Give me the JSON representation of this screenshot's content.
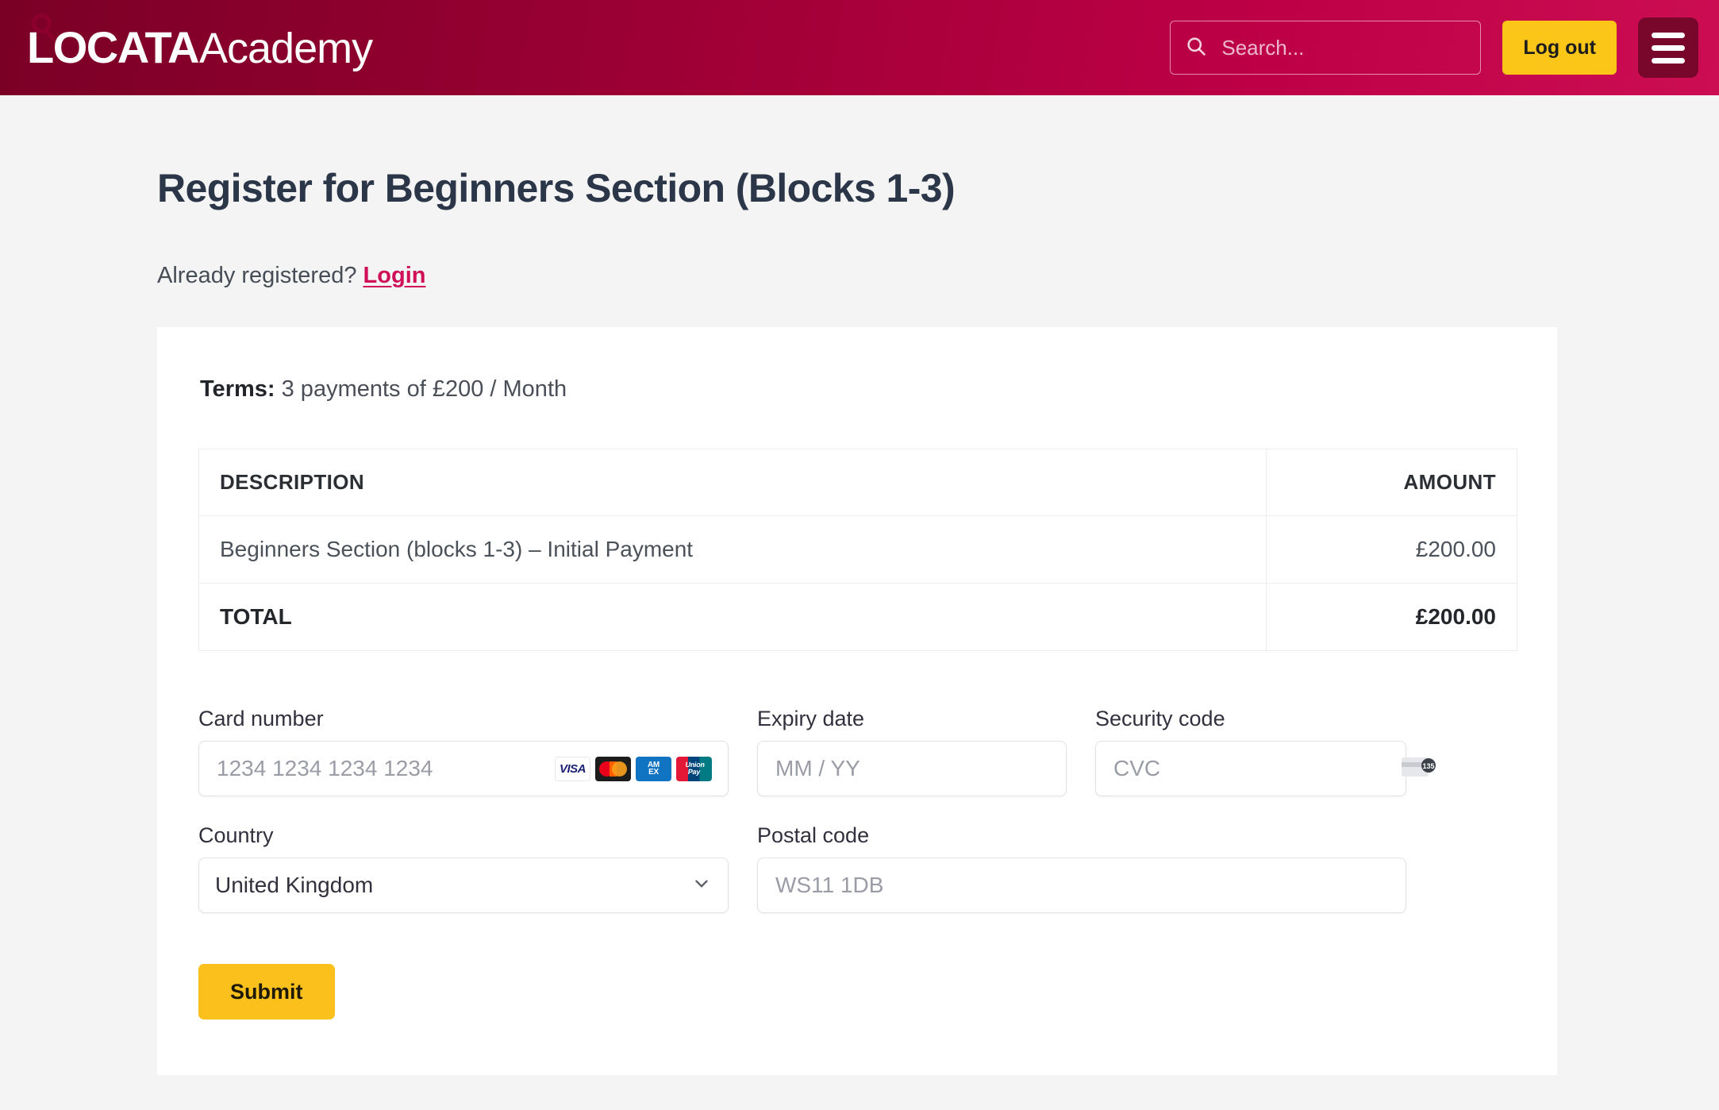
{
  "header": {
    "brand_primary": "LOCATA",
    "brand_secondary": "Academy",
    "search_placeholder": "Search...",
    "search_value": "",
    "logout_label": "Log out",
    "menu_label": "Menu",
    "gradient_from": "#7a0026",
    "gradient_to": "#cc0d52",
    "accent_yellow": "#fcc618"
  },
  "page": {
    "title": "Register for Beginners Section (Blocks 1-3)",
    "already_registered_text": "Already registered?",
    "login_link": "Login",
    "login_link_color": "#cf1059",
    "background": "#f4f4f5"
  },
  "panel": {
    "terms_label": "Terms:",
    "terms_value": "3 payments of £200 / Month"
  },
  "table": {
    "headers": [
      "DESCRIPTION",
      "AMOUNT"
    ],
    "rows": [
      {
        "description": "Beginners Section (blocks 1-3) – Initial Payment",
        "amount": "£200.00"
      }
    ],
    "total_label": "TOTAL",
    "total_amount": "£200.00"
  },
  "form": {
    "card_number": {
      "label": "Card number",
      "placeholder": "1234 1234 1234 1234",
      "value": "",
      "brands": [
        "VISA",
        "Mastercard",
        "AMEX",
        "UnionPay"
      ]
    },
    "expiry": {
      "label": "Expiry date",
      "placeholder": "MM / YY",
      "value": ""
    },
    "security_code": {
      "label": "Security code",
      "placeholder": "CVC",
      "value": "",
      "icon_digits": "135"
    },
    "country": {
      "label": "Country",
      "selected": "United Kingdom"
    },
    "postal_code": {
      "label": "Postal code",
      "placeholder": "WS11 1DB",
      "value": ""
    },
    "submit_label": "Submit"
  }
}
